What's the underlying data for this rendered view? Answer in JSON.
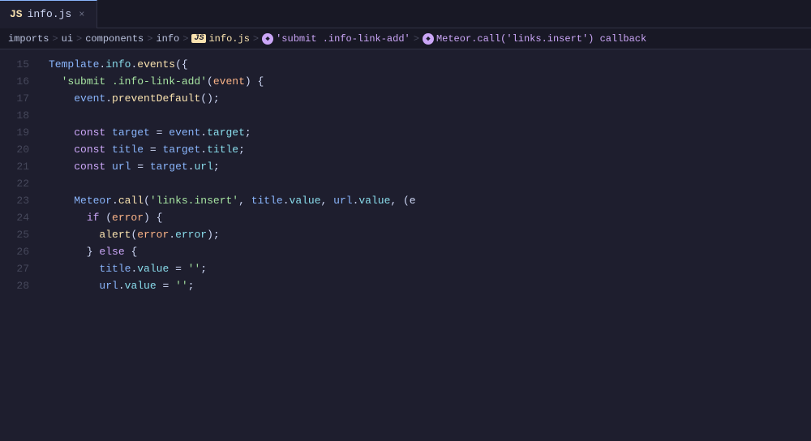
{
  "tab": {
    "icon": "JS",
    "filename": "info.js",
    "close_label": "×"
  },
  "breadcrumb": {
    "items": [
      {
        "label": "imports",
        "type": "plain"
      },
      {
        "label": ">",
        "type": "sep"
      },
      {
        "label": "ui",
        "type": "plain"
      },
      {
        "label": ">",
        "type": "sep"
      },
      {
        "label": "components",
        "type": "plain"
      },
      {
        "label": ">",
        "type": "sep"
      },
      {
        "label": "info",
        "type": "plain"
      },
      {
        "label": ">",
        "type": "sep"
      },
      {
        "label": "info.js",
        "type": "js"
      },
      {
        "label": ">",
        "type": "sep"
      },
      {
        "label": "'submit .info-link-add'",
        "type": "symbol"
      },
      {
        "label": ">",
        "type": "sep"
      },
      {
        "label": "Meteor.call('links.insert') callback",
        "type": "symbol"
      }
    ]
  },
  "lines": [
    {
      "num": "15"
    },
    {
      "num": "16"
    },
    {
      "num": "17"
    },
    {
      "num": "18"
    },
    {
      "num": "19"
    },
    {
      "num": "20"
    },
    {
      "num": "21"
    },
    {
      "num": "22"
    },
    {
      "num": "23"
    },
    {
      "num": "24"
    },
    {
      "num": "25"
    },
    {
      "num": "26"
    },
    {
      "num": "27"
    },
    {
      "num": "28"
    }
  ]
}
